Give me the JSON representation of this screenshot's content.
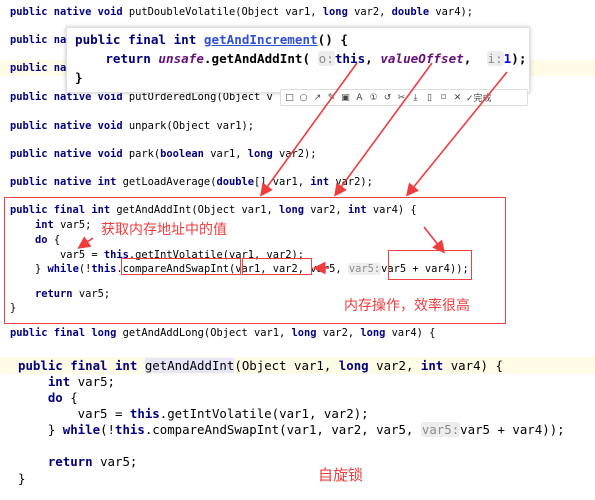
{
  "top_lines": [
    [
      [
        "public native void ",
        "kw"
      ],
      [
        "putDoubleVolatile(Object var1, ",
        ""
      ],
      [
        "long ",
        "kw"
      ],
      [
        "var2, ",
        ""
      ],
      [
        "double ",
        "kw"
      ],
      [
        "var4);",
        ""
      ]
    ],
    [
      [
        "public nat",
        "kw"
      ]
    ],
    [
      [
        "public nat",
        "kw"
      ]
    ],
    [
      [
        "public native void ",
        "kw"
      ],
      [
        "putOrderedLong(Object v",
        ""
      ]
    ],
    [
      [
        "public native void ",
        "kw"
      ],
      [
        "unpark(Object var1);",
        ""
      ]
    ],
    [
      [
        "public native void ",
        "kw"
      ],
      [
        "park(",
        ""
      ],
      [
        "boolean ",
        "kw"
      ],
      [
        "var1, ",
        ""
      ],
      [
        "long ",
        "kw"
      ],
      [
        "var2);",
        ""
      ]
    ],
    [
      [
        "public native int ",
        "kw"
      ],
      [
        "getLoadAverage(",
        ""
      ],
      [
        "double",
        "kw"
      ],
      [
        "[] var1, ",
        ""
      ],
      [
        "int ",
        "kw"
      ],
      [
        "var2);",
        ""
      ]
    ]
  ],
  "boxed_lines": [
    [
      [
        "public final int ",
        "kw"
      ],
      [
        "getAndAddInt(Object var1, ",
        ""
      ],
      [
        "long ",
        "kw"
      ],
      [
        "var2, ",
        ""
      ],
      [
        "int ",
        "kw"
      ],
      [
        "var4) {",
        ""
      ]
    ],
    [
      [
        "    ",
        ""
      ],
      [
        "int ",
        "kw"
      ],
      [
        "var5;",
        ""
      ]
    ],
    [
      [
        "    ",
        ""
      ],
      [
        "do ",
        "kw"
      ],
      [
        "{",
        ""
      ]
    ],
    [
      [
        "        var5 = ",
        ""
      ],
      [
        "this",
        "kw"
      ],
      [
        ".getIntVolatile(var1, var2);",
        ""
      ]
    ],
    [
      [
        "    } ",
        ""
      ],
      [
        "while",
        "kw"
      ],
      [
        "(!",
        ""
      ],
      [
        "this",
        "kw"
      ],
      [
        ".compareAndSwapInt(var1, var2, var5, ",
        ""
      ],
      [
        "var5:",
        "hint"
      ],
      [
        "var5 + var4));",
        ""
      ]
    ],
    [
      [
        "",
        ""
      ]
    ],
    [
      [
        "    ",
        ""
      ],
      [
        "return ",
        "kw"
      ],
      [
        "var5;",
        ""
      ]
    ],
    [
      [
        "}",
        ""
      ]
    ]
  ],
  "cut_line": [
    [
      "public final long ",
      "kw"
    ],
    [
      "getAndAddLong(Object var1, ",
      ""
    ],
    [
      "long ",
      "kw"
    ],
    [
      "var2, ",
      ""
    ],
    [
      "long ",
      "kw"
    ],
    [
      "var4) {",
      ""
    ]
  ],
  "popup_lines": [
    [
      [
        "public final int ",
        "kw"
      ],
      [
        "getAndIncrement",
        "lnk"
      ],
      [
        "() {",
        ""
      ]
    ],
    [
      [
        "    ",
        ""
      ],
      [
        "return ",
        "kw"
      ],
      [
        "unsafe",
        "it"
      ],
      [
        ".getAndAddInt( ",
        ""
      ],
      [
        "o:",
        "hint"
      ],
      [
        "this",
        "kw"
      ],
      [
        ", ",
        ""
      ],
      [
        "valueOffset",
        "it"
      ],
      [
        ",  ",
        ""
      ],
      [
        "i:",
        "hint"
      ],
      [
        "1",
        "num"
      ],
      [
        ");",
        ""
      ]
    ],
    [
      [
        "}",
        ""
      ]
    ]
  ],
  "toolbar": [
    "□",
    "○",
    "↗",
    "✎",
    "▣",
    "A",
    "①",
    "↺",
    "✂",
    "⤓",
    "▯",
    "⌑",
    "✕",
    "✓完成"
  ],
  "bottom_lines": [
    [
      [
        "public final int ",
        "kw"
      ],
      [
        "getAndAddInt",
        "hl"
      ],
      [
        "(Object var1, ",
        ""
      ],
      [
        "long ",
        "kw"
      ],
      [
        "var2, ",
        ""
      ],
      [
        "int ",
        "kw"
      ],
      [
        "var4) {",
        ""
      ]
    ],
    [
      [
        "    ",
        ""
      ],
      [
        "int ",
        "kw"
      ],
      [
        "var5;",
        ""
      ]
    ],
    [
      [
        "    ",
        ""
      ],
      [
        "do ",
        "kw"
      ],
      [
        "{",
        ""
      ]
    ],
    [
      [
        "        var5 = ",
        ""
      ],
      [
        "this",
        "kw"
      ],
      [
        ".getIntVolatile(var1, var2);",
        ""
      ]
    ],
    [
      [
        "    } ",
        ""
      ],
      [
        "while",
        "kw"
      ],
      [
        "(!",
        ""
      ],
      [
        "this",
        "kw"
      ],
      [
        ".compareAndSwapInt(var1, var2, var5, ",
        ""
      ],
      [
        "var5:",
        "hint"
      ],
      [
        "var5 + var4));",
        ""
      ]
    ],
    [
      [
        "",
        ""
      ]
    ],
    [
      [
        "    ",
        ""
      ],
      [
        "return ",
        "kw"
      ],
      [
        "var5;",
        ""
      ]
    ],
    [
      [
        "}",
        ""
      ]
    ]
  ],
  "annotations": {
    "get_memory_value": "获取内存地址中的值",
    "memory_op": "内存操作，效率很高",
    "spin_lock": "自旋锁"
  },
  "colors": {
    "annotation": "#f03c3c",
    "keyword": "#000080",
    "current_line": "#fffbe6"
  }
}
